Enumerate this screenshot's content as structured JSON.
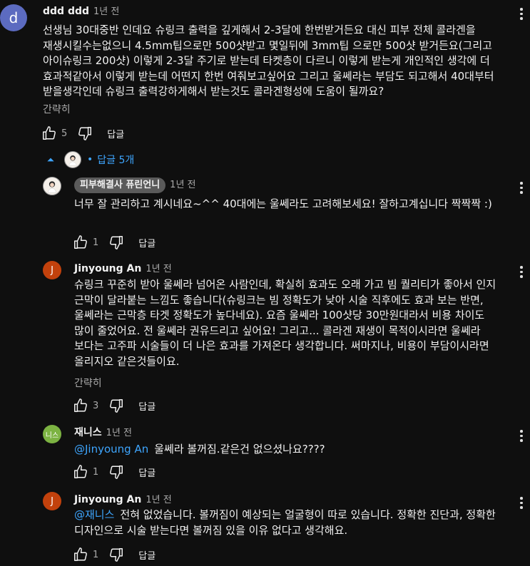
{
  "comment": {
    "avatar_letter": "d",
    "avatar_color": "#5c6bc0",
    "author": "ddd ddd",
    "time": "1년 전",
    "text": "선생님 30대중반 인데요  슈링크 출력을 깊게해서 2-3달에 한번받거든요 대신 피부 전체 콜라겐을 재생시킬수는없으니 4.5mm팁으로만 500샷받고 몇일뒤에 3mm팁 으로만 500샷 받거든요(그리고 아이슈링크 200샷) 이렇게 2-3달 주기로 받는데 타켓층이 다르니 이렇게 받는게 개인적인 생각에 더 효과적같아서 이렇게 받는데 어떤지 한번 여줘보고싶어요 그리고 울쎄라는 부담도 되고해서 40대부터 받을생각인데 슈링크 출력강하게해서 받는것도 콜라겐형성에 도움이 될까요?",
    "show_less": "간략히",
    "likes": "5",
    "reply_label": "답글"
  },
  "replies_toggle": {
    "label": "답글 5개",
    "bullet": "•"
  },
  "replies": [
    {
      "avatar_type": "image",
      "author": "피부해결사 퓨린언니",
      "author_is_creator": true,
      "time": "1년 전",
      "mention": "",
      "text": "너무 잘 관리하고 계시네요~^^ 40대에는 울쎄라도 고려해보세요! 잘하고계십니다 짝짝짝 :)",
      "show_less": "",
      "likes": "1",
      "reply_label": "답글"
    },
    {
      "avatar_type": "letter",
      "avatar_letter": "J",
      "avatar_color": "#c2410c",
      "author": "Jinyoung An",
      "time": "1년 전",
      "mention": "",
      "text": "슈링크 꾸준히 받아 울쎄라 넘어온 사람인데, 확실히 효과도 오래 가고 빔 퀄리티가 좋아서 인지 근막이 달라붙는 느낌도 좋습니다(슈링크는 빔 정확도가 낮아 시술 직후에도 효과 보는 반면, 울쎄라는 근막층 타겟 정확도가 높다네요). 요즘 울쎄라 100샷당 30만원대라서 비용 차이도 많이 줄었어요. 전 울쎄라 권유드리고 싶어요! 그리고... 콜라겐 재생이 목적이시라면 울쎄라 보다는 고주파 시술들이 더 나은 효과를 가져온다 생각합니다. 써마지나, 비용이 부담이시라면 올리지오 같은것들이요.",
      "show_less": "간략히",
      "likes": "3",
      "reply_label": "답글"
    },
    {
      "avatar_type": "letter",
      "avatar_letter": "니스",
      "avatar_color": "#7cb342",
      "author": "재니스",
      "time": "1년 전",
      "mention": "@Jinyoung An",
      "text": "울쎄라 볼꺼짐.같은건 없으셨나요????",
      "show_less": "",
      "likes": "1",
      "reply_label": "답글"
    },
    {
      "avatar_type": "letter",
      "avatar_letter": "J",
      "avatar_color": "#c2410c",
      "author": "Jinyoung An",
      "time": "1년 전",
      "mention": "@재니스",
      "text": "전혀 없었습니다. 볼꺼짐이 예상되는 얼굴형이 따로 있습니다. 정확한 진단과, 정확한 디자인으로 시술 받는다면 볼꺼짐 있을 이유 없다고 생각해요.",
      "show_less": "",
      "likes": "1",
      "reply_label": "답글"
    }
  ]
}
